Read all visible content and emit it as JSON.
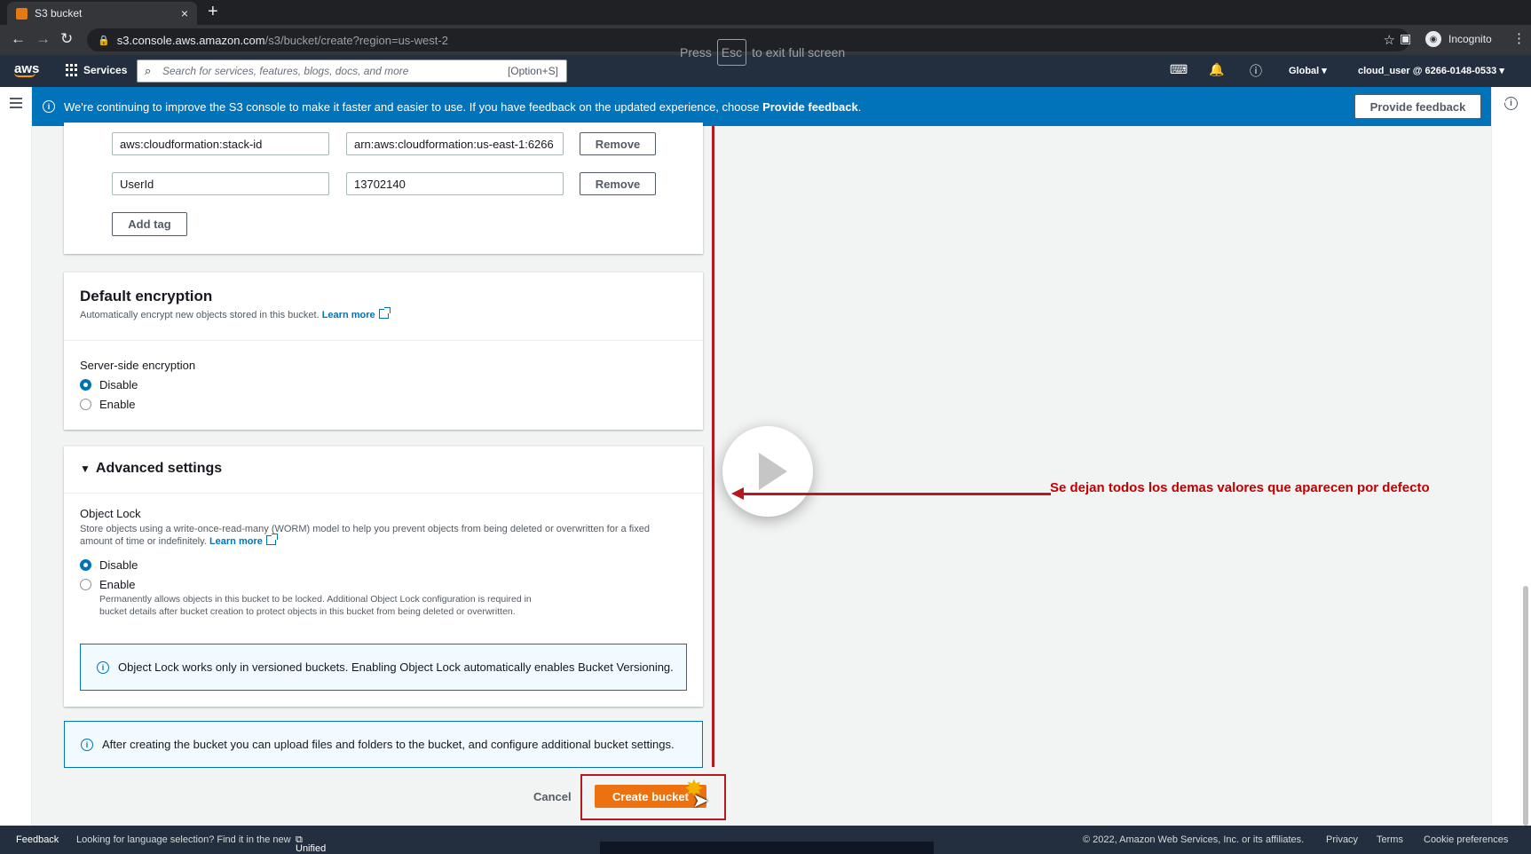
{
  "browser": {
    "tab_title": "S3 bucket",
    "tab_close": "×",
    "new_tab": "+",
    "url_host": "s3.console.aws.amazon.com",
    "url_path": "/s3/bucket/create?region=us-west-2",
    "profile": "Incognito",
    "fullscreen_hint_pre": "Press",
    "fullscreen_hint_key": "Esc",
    "fullscreen_hint_post": "to exit full screen"
  },
  "awsnav": {
    "logo": "aws",
    "services": "Services",
    "search_placeholder": "Search for services, features, blogs, docs, and more",
    "search_shortcut": "[Option+S]",
    "region": "Global ▾",
    "account": "cloud_user @ 6266-0148-0533 ▾"
  },
  "flash": {
    "text": "We're continuing to improve the S3 console to make it faster and easier to use. If you have feedback on the updated experience, choose",
    "text_bold": "Provide feedback",
    "text_end": ".",
    "button": "Provide feedback"
  },
  "tags": {
    "rows": [
      {
        "key": "aws:cloudformation:stack-id",
        "value": "arn:aws:cloudformation:us-east-1:6266",
        "remove": "Remove"
      },
      {
        "key": "UserId",
        "value": "13702140",
        "remove": "Remove"
      }
    ],
    "add_tag": "Add tag"
  },
  "encryption": {
    "title": "Default encryption",
    "description": "Automatically encrypt new objects stored in this bucket.",
    "learn_more": "Learn more",
    "field_label": "Server-side encryption",
    "options": [
      {
        "label": "Disable",
        "selected": true
      },
      {
        "label": "Enable",
        "selected": false
      }
    ]
  },
  "advanced": {
    "title": "Advanced settings",
    "object_lock_label": "Object Lock",
    "object_lock_desc": "Store objects using a write-once-read-many (WORM) model to help you prevent objects from being deleted or overwritten for a fixed amount of time or indefinitely.",
    "learn_more": "Learn more",
    "options": [
      {
        "label": "Disable",
        "selected": true
      },
      {
        "label": "Enable",
        "selected": false
      }
    ],
    "enable_desc": "Permanently allows objects in this bucket to be locked. Additional Object Lock configuration is required in bucket details after bucket creation to protect objects in this bucket from being deleted or overwritten.",
    "info": "Object Lock works only in versioned buckets. Enabling Object Lock automatically enables Bucket Versioning."
  },
  "after_info": "After creating the bucket you can upload files and folders to the bucket, and configure additional bucket settings.",
  "actions": {
    "cancel": "Cancel",
    "create": "Create bucket"
  },
  "annotation": "Se dejan todos los demas valores que aparecen por defecto",
  "footer": {
    "feedback": "Feedback",
    "language_text": "Looking for language selection? Find it in the new",
    "unified": "Unified Settings",
    "copyright": "© 2022, Amazon Web Services, Inc. or its affiliates.",
    "privacy": "Privacy",
    "terms": "Terms",
    "cookies": "Cookie preferences"
  },
  "colors": {
    "aws_nav": "#232f3e",
    "flash_blue": "#0073bb",
    "primary_orange": "#ec7211",
    "annotation_red": "#b41a1f"
  }
}
